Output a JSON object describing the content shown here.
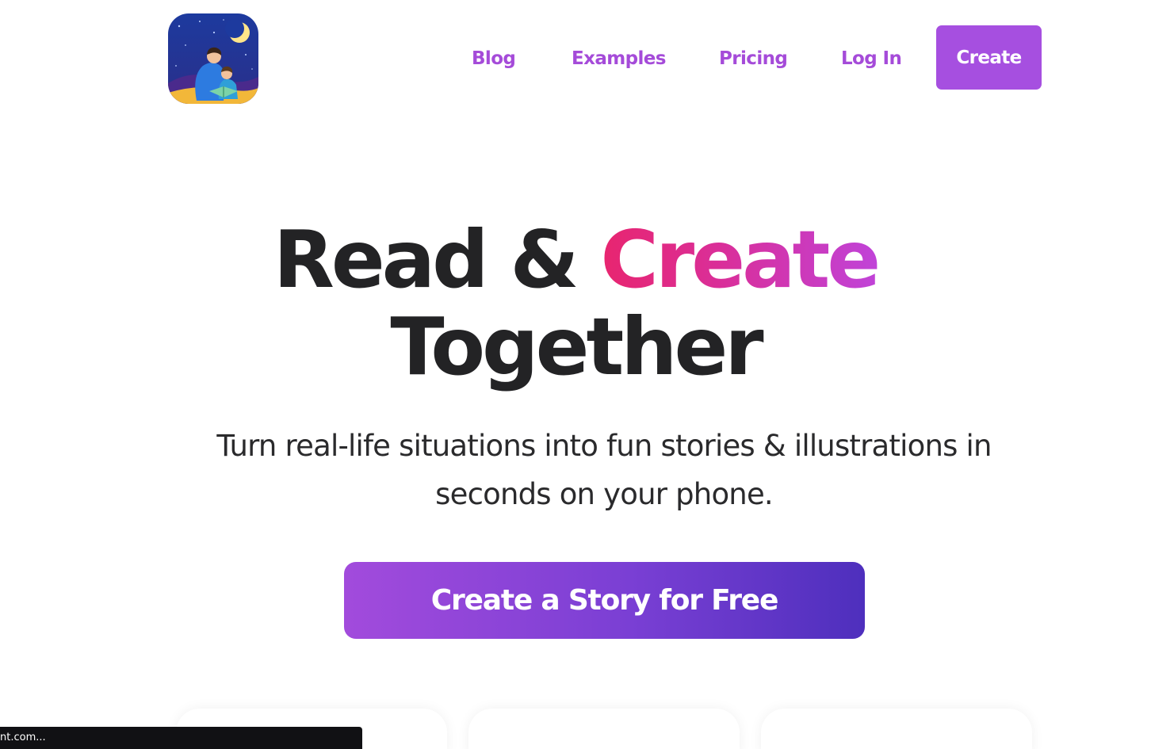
{
  "header": {
    "logo_icon": "parent-reading-book-to-child-under-moon-icon",
    "nav": {
      "blog": "Blog",
      "examples": "Examples",
      "pricing": "Pricing",
      "login": "Log In",
      "create": "Create"
    }
  },
  "hero": {
    "title_part1": "Read & ",
    "title_accent": "Create",
    "title_line2": "Together",
    "subtitle": "Turn real-life situations into fun stories & illustrations in seconds on your phone.",
    "cta": "Create a Story for Free"
  },
  "status_bar": {
    "url_text": "nt.com..."
  },
  "colors": {
    "nav_text": "#a54bd9",
    "nav_button": "#a64fe0",
    "headline": "#232325",
    "accent_start": "#e8256f",
    "accent_end": "#c043d8",
    "cta_start": "#a24bdc",
    "cta_end": "#4e2fbd"
  }
}
